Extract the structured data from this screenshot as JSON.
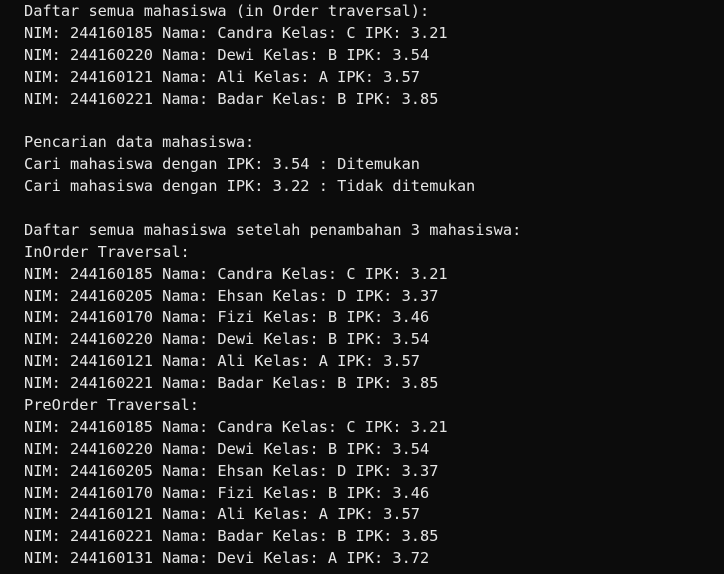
{
  "terminal": {
    "lines": [
      "Daftar semua mahasiswa (in Order traversal):",
      "NIM: 244160185 Nama: Candra Kelas: C IPK: 3.21",
      "NIM: 244160220 Nama: Dewi Kelas: B IPK: 3.54",
      "NIM: 244160121 Nama: Ali Kelas: A IPK: 3.57",
      "NIM: 244160221 Nama: Badar Kelas: B IPK: 3.85",
      "",
      "Pencarian data mahasiswa:",
      "Cari mahasiswa dengan IPK: 3.54 : Ditemukan",
      "Cari mahasiswa dengan IPK: 3.22 : Tidak ditemukan",
      "",
      "Daftar semua mahasiswa setelah penambahan 3 mahasiswa:",
      "InOrder Traversal:",
      "NIM: 244160185 Nama: Candra Kelas: C IPK: 3.21",
      "NIM: 244160205 Nama: Ehsan Kelas: D IPK: 3.37",
      "NIM: 244160170 Nama: Fizi Kelas: B IPK: 3.46",
      "NIM: 244160220 Nama: Dewi Kelas: B IPK: 3.54",
      "NIM: 244160121 Nama: Ali Kelas: A IPK: 3.57",
      "NIM: 244160221 Nama: Badar Kelas: B IPK: 3.85",
      "PreOrder Traversal:",
      "NIM: 244160185 Nama: Candra Kelas: C IPK: 3.21",
      "NIM: 244160220 Nama: Dewi Kelas: B IPK: 3.54",
      "NIM: 244160205 Nama: Ehsan Kelas: D IPK: 3.37",
      "NIM: 244160170 Nama: Fizi Kelas: B IPK: 3.46",
      "NIM: 244160121 Nama: Ali Kelas: A IPK: 3.57",
      "NIM: 244160221 Nama: Badar Kelas: B IPK: 3.85",
      "NIM: 244160131 Nama: Devi Kelas: A IPK: 3.72"
    ]
  },
  "colors": {
    "background": "#0c0c0c",
    "text": "#e6e6e6"
  }
}
